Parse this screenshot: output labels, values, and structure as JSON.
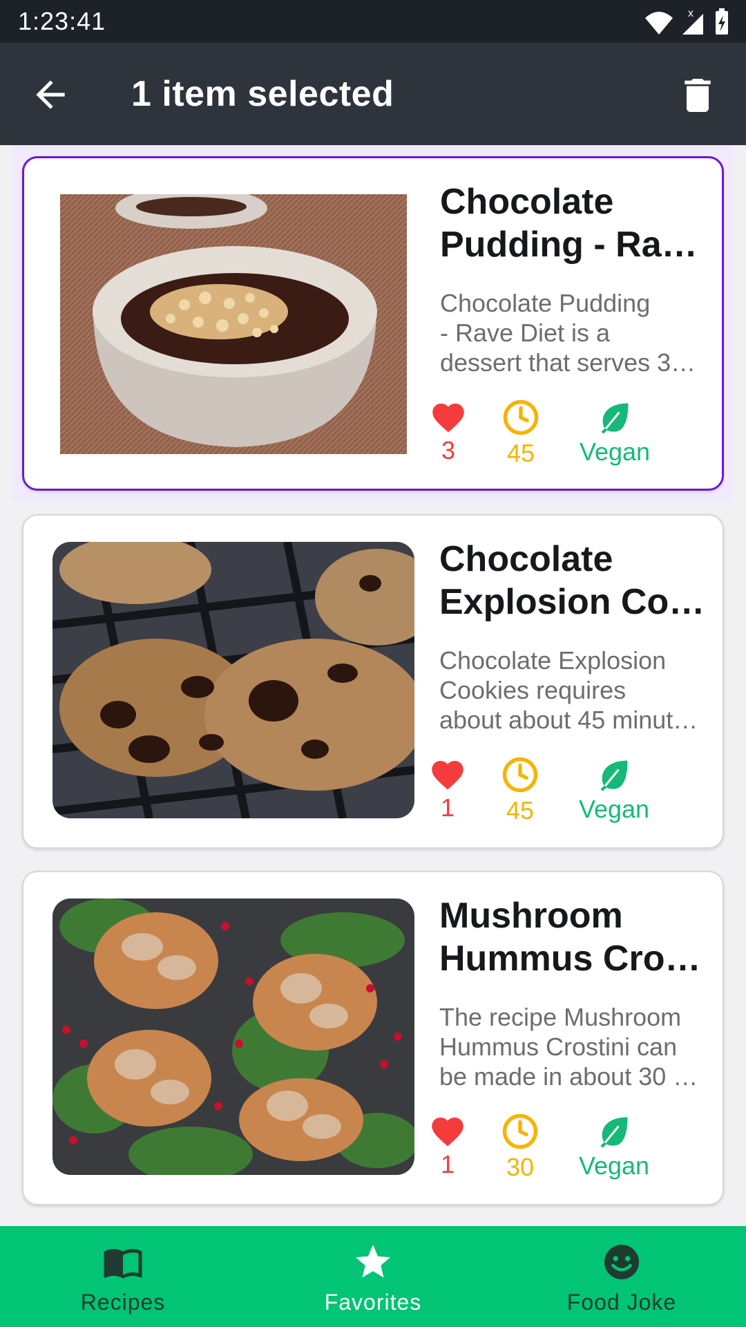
{
  "status_bar": {
    "time": "1:23:41"
  },
  "app_bar": {
    "title": "1 item selected"
  },
  "recipes": [
    {
      "title_lines": [
        "Chocolate",
        "Pudding - Rav…"
      ],
      "desc_lines": [
        "Chocolate Pudding",
        "- Rave Diet is a",
        "dessert that serves 3…"
      ],
      "likes": "3",
      "minutes": "45",
      "diet": "Vegan",
      "selected": true
    },
    {
      "title_lines": [
        "Chocolate",
        "Explosion Co…"
      ],
      "desc_lines": [
        "Chocolate Explosion",
        "Cookies requires",
        "about about 45 minut…"
      ],
      "likes": "1",
      "minutes": "45",
      "diet": "Vegan",
      "selected": false
    },
    {
      "title_lines": [
        "Mushroom",
        "Hummus Cros…"
      ],
      "desc_lines": [
        "The recipe Mushroom",
        "Hummus Crostini can",
        "be made in about 30 …"
      ],
      "likes": "1",
      "minutes": "30",
      "diet": "Vegan",
      "selected": false
    }
  ],
  "bottom_nav": {
    "items": [
      {
        "label": "Recipes",
        "icon": "book-icon",
        "active": false
      },
      {
        "label": "Favorites",
        "icon": "star-icon",
        "active": true
      },
      {
        "label": "Food Joke",
        "icon": "smiley-icon",
        "active": false
      }
    ]
  },
  "colors": {
    "app_bar": "#2e343b",
    "selection_outline": "#6a1ad0",
    "likes": "#f53c3c",
    "time": "#f5b400",
    "vegan": "#15b978",
    "bottom_nav": "#01c474"
  }
}
